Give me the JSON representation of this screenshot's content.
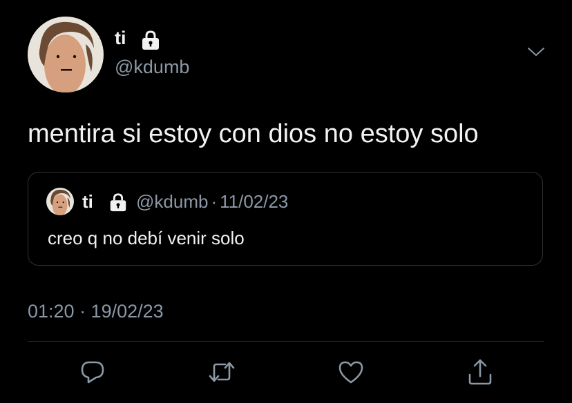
{
  "tweet": {
    "author": {
      "display_name": "ti",
      "handle": "@kdumb",
      "avatar_icon": "avatar-icon",
      "protected_icon": "lock-icon"
    },
    "menu_icon": "chevron-down-icon",
    "text": "mentira si estoy con dios no estoy solo",
    "quoted_tweet": {
      "display_name": "ti",
      "handle": "@kdumb",
      "separator": "·",
      "date": "11/02/23",
      "text": "creo q no debí venir solo"
    },
    "timestamp": "01:20 · 19/02/23",
    "actions": [
      {
        "name": "reply",
        "icon": "reply-icon"
      },
      {
        "name": "retweet",
        "icon": "retweet-icon"
      },
      {
        "name": "like",
        "icon": "heart-icon"
      },
      {
        "name": "share",
        "icon": "share-icon"
      }
    ]
  },
  "colors": {
    "background": "#000000",
    "primary_text": "#f2f2f2",
    "secondary_text": "#8b98a5",
    "border": "#2f3336",
    "icon": "#8b98a5"
  }
}
